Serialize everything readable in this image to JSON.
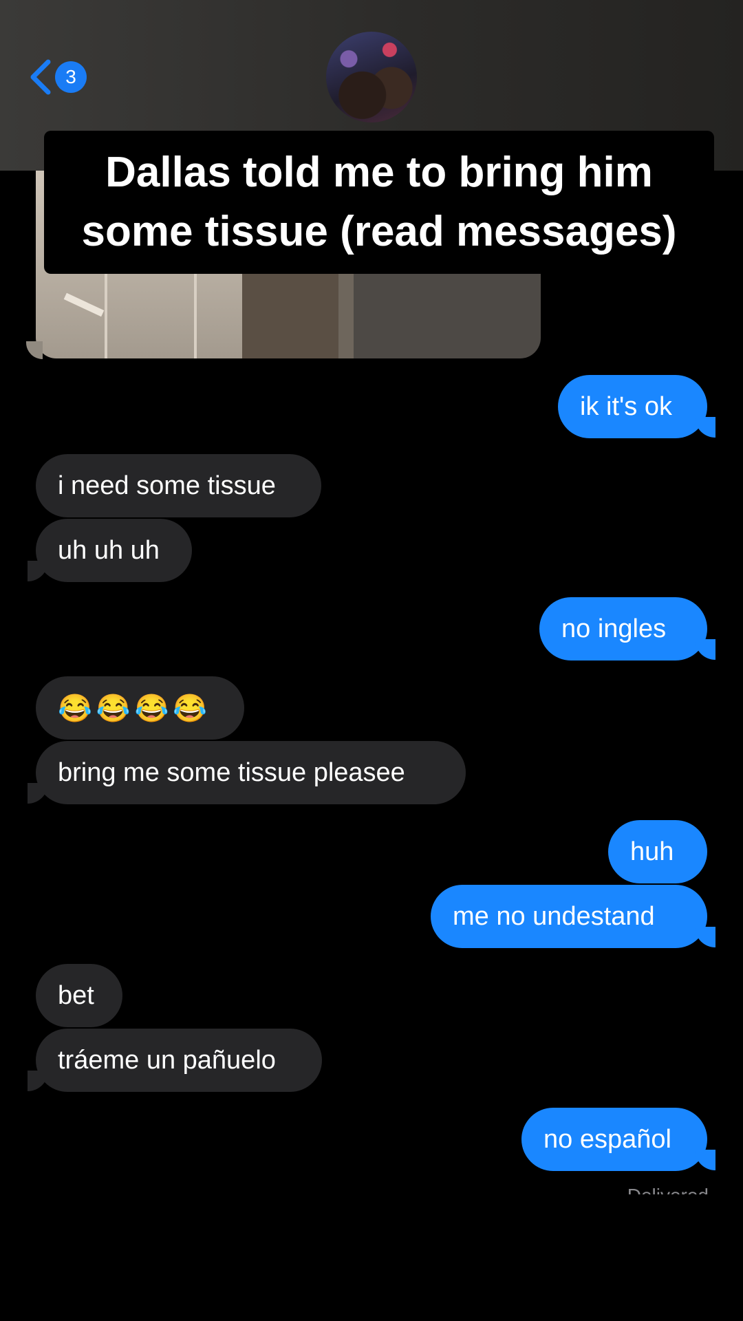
{
  "header": {
    "back_label": "Back",
    "unread_count": "3"
  },
  "caption": {
    "line1": "Dallas told me to bring him",
    "line2": "some tissue (read messages)"
  },
  "messages": [
    {
      "from": "me",
      "text": "ik it's ok"
    },
    {
      "from": "them",
      "text": "i need some tissue"
    },
    {
      "from": "them",
      "text": "uh uh uh"
    },
    {
      "from": "me",
      "text": "no ingles"
    },
    {
      "from": "them",
      "text": "😂😂😂😂"
    },
    {
      "from": "them",
      "text": "bring me some tissue pleasee"
    },
    {
      "from": "me",
      "text": "huh"
    },
    {
      "from": "me",
      "text": "me no undestand"
    },
    {
      "from": "them",
      "text": "bet"
    },
    {
      "from": "them",
      "text": "tráeme un pañuelo"
    },
    {
      "from": "me",
      "text": "no español"
    }
  ],
  "status": "Delivered",
  "colors": {
    "sent_bubble": "#1a87ff",
    "received_bubble": "#262628",
    "badge": "#1a7cf5",
    "background": "#000000"
  }
}
